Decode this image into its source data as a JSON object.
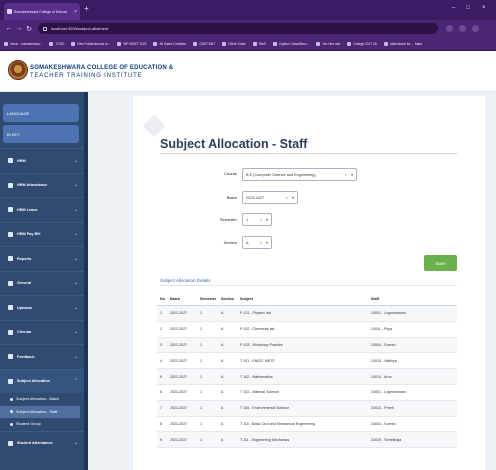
{
  "browser": {
    "tab_title": "Somakeshwara College of Educat",
    "url": "localhost:3000/subject-allotment",
    "bookmarks": [
      "Varun - somakeshwa...",
      "TCDO",
      "New Folder/samoa m...",
      "WP MGET 1023",
      "All Gates Crosfeed",
      "GATE SMT",
      "Client Guide",
      "SteS",
      "Caption Class/Beco...",
      "Ver-Hue neb",
      "College 2017-18",
      "Attendance for ... Mata"
    ]
  },
  "header": {
    "college_line1": "SOMAKESHWARA COLLEGE OF EDUCATION &",
    "college_line2": "TEACHER TRAINING INSTITUTE"
  },
  "sidebar": {
    "top_buttons": [
      "LANGUAGE",
      "BI KEY"
    ],
    "menu": [
      {
        "label": "HRM"
      },
      {
        "label": "HRM Attendance"
      },
      {
        "label": "HRM Leave"
      },
      {
        "label": "HRM Pay Bill"
      },
      {
        "label": "Reports"
      },
      {
        "label": "General"
      },
      {
        "label": "Uploads"
      },
      {
        "label": "Circular"
      },
      {
        "label": "Feedback"
      },
      {
        "label": "Subject Allocation"
      }
    ],
    "submenu": [
      {
        "label": "Subject Allocation - Batch"
      },
      {
        "label": "Subject Allocation - Staff"
      },
      {
        "label": "Student Group"
      }
    ],
    "last_item": {
      "label": "Student Attendance"
    }
  },
  "page": {
    "title": "Subject Allocation - Staff",
    "form": {
      "course_label": "Course",
      "course_value": "B.E (Computer Science and Engineering)",
      "batch_label": "Batch",
      "batch_value": "2023-2027",
      "semester_label": "Semester",
      "semester_value": "1",
      "section_label": "Section",
      "section_value": "A"
    },
    "save_label": "Save",
    "section_title": "Subject Allocation Details",
    "table": {
      "headers": [
        "No.",
        "Batch",
        "Semester",
        "Section",
        "Subject",
        "Staff"
      ],
      "rows": [
        [
          "1",
          "2023-2027",
          "1",
          "A",
          "P 101 - Physics lab",
          "24001 - Logeshwaran"
        ],
        [
          "2",
          "2023-2027",
          "1",
          "A",
          "P 102 - Chemistry lab",
          "24011 - Priya"
        ],
        [
          "3",
          "2023-2027",
          "1",
          "A",
          "P 103 - Workshop Practice",
          "24004 - Suresh"
        ],
        [
          "4",
          "2023-2027",
          "1",
          "A",
          "T 101 - ENGG. MEST",
          "24015 - Vaithiya"
        ],
        [
          "5",
          "2023-2027",
          "1",
          "A",
          "T 102 - Mathematics",
          "24010 - Arun"
        ],
        [
          "6",
          "2023-2027",
          "1",
          "A",
          "T 103 - Material Science",
          "24001 - Logeshwaran"
        ],
        [
          "7",
          "2023-2027",
          "1",
          "A",
          "T 105 - Environmental Science",
          "24013 - Preeti"
        ],
        [
          "8",
          "2023-2027",
          "1",
          "A",
          "T 110 - Basic Civil and Mechanical Engineering",
          "24004 - Suresh"
        ],
        [
          "9",
          "2023-2027",
          "1",
          "A",
          "T 111 - Engineering Mechanics",
          "24025 - Senthilraja"
        ]
      ]
    }
  }
}
